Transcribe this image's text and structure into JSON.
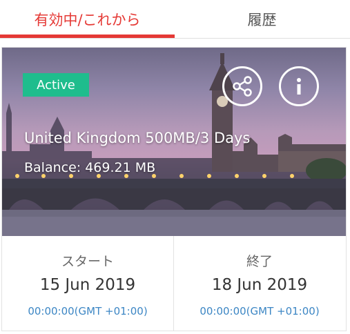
{
  "tabs": {
    "active_label": "有効中/これから",
    "history_label": "履歴"
  },
  "plan": {
    "status": "Active",
    "title": "United Kingdom 500MB/3 Days",
    "balance": "Balance: 469.21 MB",
    "share_icon": "share-icon",
    "info_icon": "info-icon"
  },
  "start": {
    "label": "スタート",
    "date": "15 Jun 2019",
    "time": "00:00:00(GMT +01:00)"
  },
  "end": {
    "label": "終了",
    "date": "18 Jun 2019",
    "time": "00:00:00(GMT +01:00)"
  },
  "colors": {
    "accent": "#e53935",
    "badge": "#1fbd8d",
    "time_text": "#3c86c4"
  }
}
